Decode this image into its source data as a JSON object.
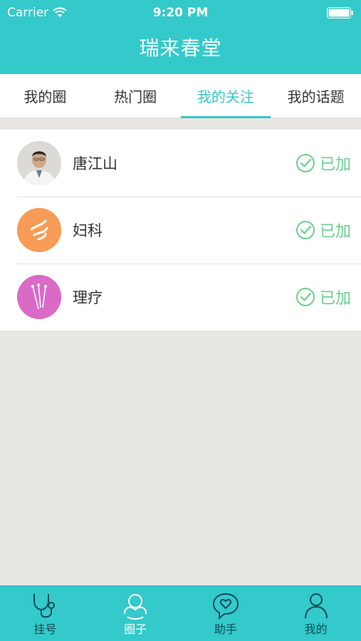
{
  "status": {
    "carrier": "Carrier",
    "time": "9:20 PM"
  },
  "app": {
    "title": "瑞来春堂"
  },
  "tabs": [
    {
      "label": "我的圈",
      "active": false
    },
    {
      "label": "热门圈",
      "active": false
    },
    {
      "label": "我的关注",
      "active": true
    },
    {
      "label": "我的话题",
      "active": false
    }
  ],
  "list": [
    {
      "name": "唐江山",
      "status": "已加",
      "avatar_icon": "doctor-photo-avatar",
      "avatar_color": "#c9c6c0"
    },
    {
      "name": "妇科",
      "status": "已加",
      "avatar_icon": "gynecology-icon",
      "avatar_color": "#f79b56"
    },
    {
      "name": "理疗",
      "status": "已加",
      "avatar_icon": "acupuncture-needles-icon",
      "avatar_color": "#d96ac6"
    }
  ],
  "bottom_nav": [
    {
      "label": "挂号",
      "icon": "stethoscope-icon",
      "active": false
    },
    {
      "label": "圈子",
      "icon": "circle-people-icon",
      "active": true
    },
    {
      "label": "助手",
      "icon": "heart-chat-icon",
      "active": false
    },
    {
      "label": "我的",
      "icon": "user-icon",
      "active": false
    }
  ],
  "colors": {
    "accent": "#34c9cb",
    "joined": "#6bd08e",
    "background": "#e7e6e2"
  }
}
